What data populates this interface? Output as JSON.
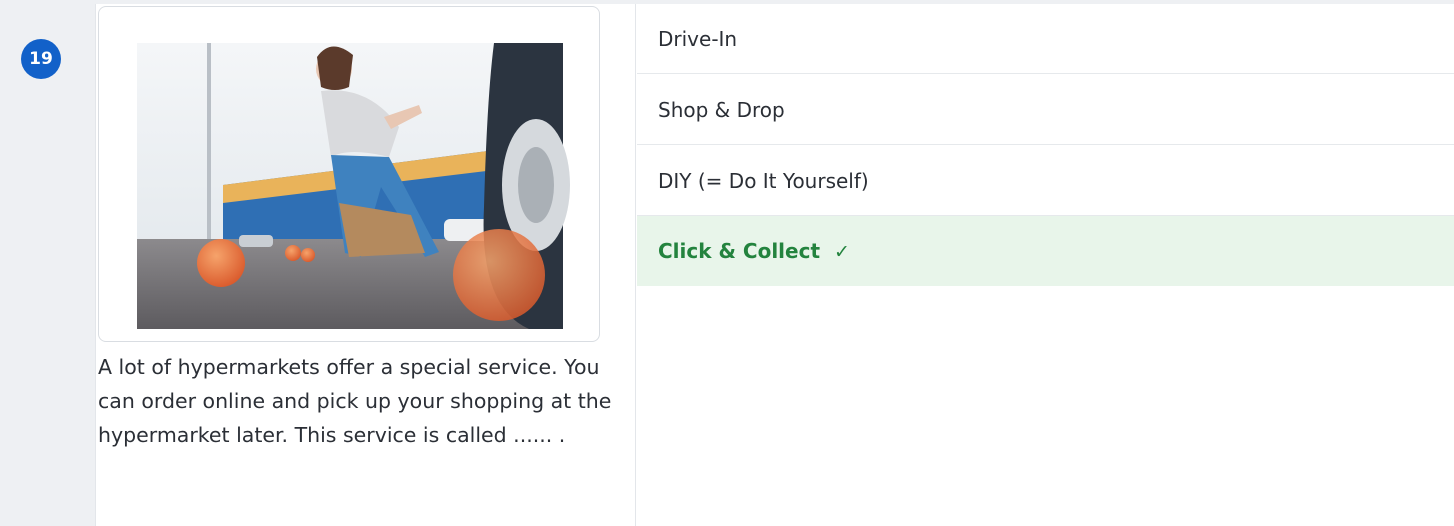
{
  "question": {
    "number": "19",
    "text": "A lot of hypermarkets offer a special service. You can order online and pick up your shopping at the hypermarket later. This service is called ...... ."
  },
  "image": {
    "icon": "photo-woman-dropping-shopping-bag-parking-lot"
  },
  "options": [
    {
      "label": "Drive-In",
      "state": "neutral"
    },
    {
      "label": "Shop & Drop",
      "state": "neutral"
    },
    {
      "label": "DIY (= Do It Yourself)",
      "state": "neutral"
    },
    {
      "label": "Click & Collect",
      "state": "correct",
      "mark": "✓"
    }
  ],
  "colors": {
    "badge": "#1261c9",
    "correct_bg": "#e8f5ea",
    "correct_text": "#23833e",
    "gutter": "#eef0f3"
  }
}
